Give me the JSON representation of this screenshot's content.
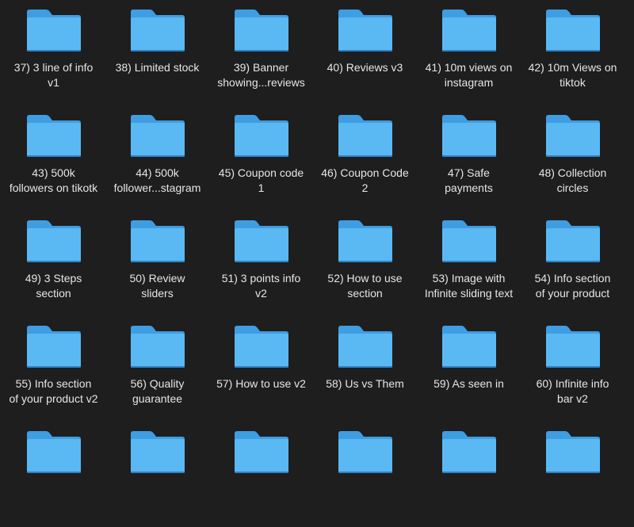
{
  "folder_colors": {
    "back": "#3f9de2",
    "front": "#5ab9f3",
    "shadow": "#2f82c4"
  },
  "rows": [
    [
      {
        "label": "37) 3 line of info\nv1"
      },
      {
        "label": "38) Limited stock"
      },
      {
        "label": "39) Banner\nshowing...reviews"
      },
      {
        "label": "40) Reviews v3"
      },
      {
        "label": "41) 10m views on\ninstagram"
      },
      {
        "label": "42) 10m Views on\ntiktok"
      }
    ],
    [
      {
        "label": "43) 500k\nfollowers on tikotk"
      },
      {
        "label": "44) 500k\nfollower...stagram"
      },
      {
        "label": "45) Coupon code\n1"
      },
      {
        "label": "46) Coupon Code\n2"
      },
      {
        "label": "47) Safe\npayments"
      },
      {
        "label": "48) Collection\ncircles"
      }
    ],
    [
      {
        "label": "49) 3 Steps\nsection"
      },
      {
        "label": "50) Review\nsliders"
      },
      {
        "label": "51) 3 points info\nv2"
      },
      {
        "label": "52)  How to use\nsection"
      },
      {
        "label": "53) Image with\nInfinite sliding text"
      },
      {
        "label": "54) Info section\nof your product"
      }
    ],
    [
      {
        "label": "55) Info section\nof your product v2"
      },
      {
        "label": "56) Quality\nguarantee"
      },
      {
        "label": "57) How to use v2"
      },
      {
        "label": "58) Us vs Them"
      },
      {
        "label": "59) As seen in"
      },
      {
        "label": "60) Infinite info\nbar v2"
      }
    ],
    [
      {
        "label": ""
      },
      {
        "label": ""
      },
      {
        "label": ""
      },
      {
        "label": ""
      },
      {
        "label": ""
      },
      {
        "label": ""
      }
    ]
  ]
}
